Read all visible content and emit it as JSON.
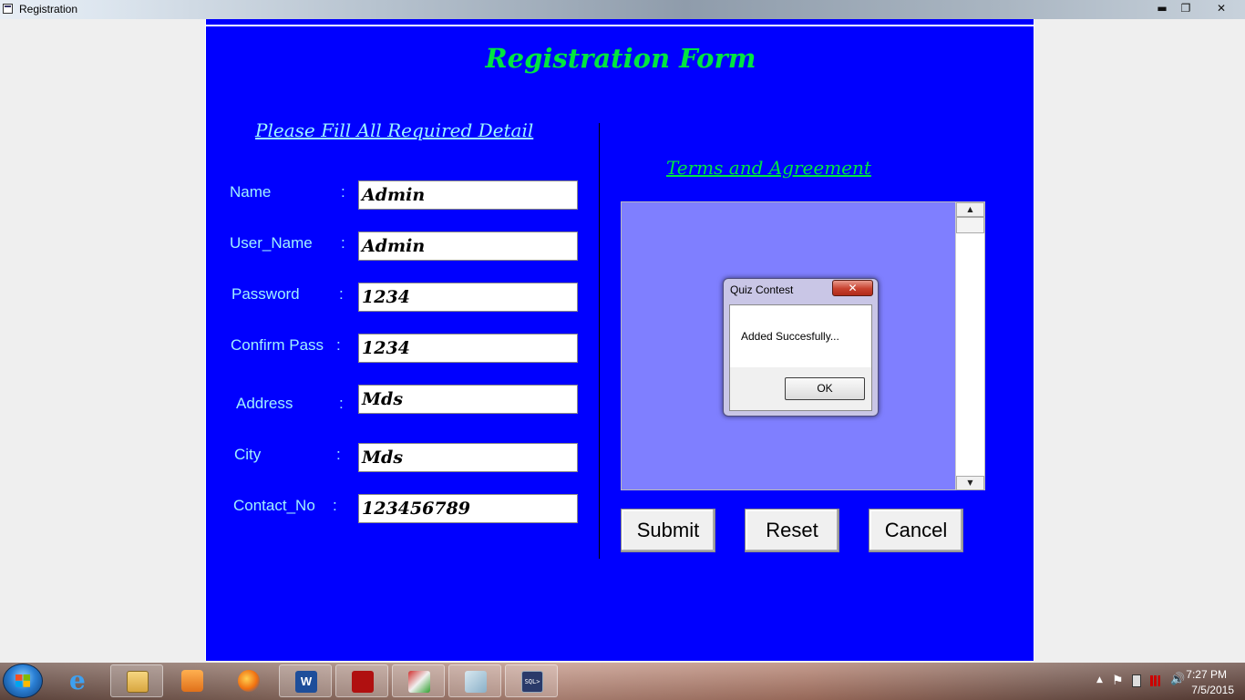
{
  "window": {
    "title": "Registration",
    "minimize": "▬",
    "maximize": "❐",
    "close": "✕"
  },
  "form": {
    "title": "Registration Form",
    "fill_heading": "Please Fill All Required Detail",
    "terms_heading": "Terms and Agreement",
    "fields": [
      {
        "label": "Name",
        "value": "Admin"
      },
      {
        "label": "User_Name",
        "value": "Admin"
      },
      {
        "label": "Password",
        "value": "1234"
      },
      {
        "label": "Confirm Pass",
        "value": "1234"
      },
      {
        "label": "Address",
        "value": "Mds"
      },
      {
        "label": "City",
        "value": "Mds"
      },
      {
        "label": "Contact_No",
        "value": "123456789"
      }
    ],
    "colon": ":",
    "buttons": {
      "submit": "Submit",
      "reset": "Reset",
      "cancel": "Cancel"
    },
    "scroll_up": "▲",
    "scroll_down": "▼"
  },
  "dialog": {
    "title": "Quiz Contest",
    "close": "✕",
    "message": "Added Succesfully...",
    "ok": "OK"
  },
  "taskbar": {
    "apps": [
      "start-icon",
      "internet-explorer-icon",
      "file-explorer-icon",
      "media-player-icon",
      "firefox-icon",
      "word-icon",
      "acrobat-icon",
      "paint-icon",
      "notepad-icon",
      "sql-icon"
    ],
    "time": "7:27 PM",
    "date": "7/5/2015",
    "tray_expand": "▲",
    "flag": "⚑",
    "volume": "🔊"
  },
  "colors": {
    "form_bg": "#0000ff",
    "heading_green": "#00e640",
    "label_cyan": "#a0f0ff",
    "terms_box": "#7f7fff"
  }
}
